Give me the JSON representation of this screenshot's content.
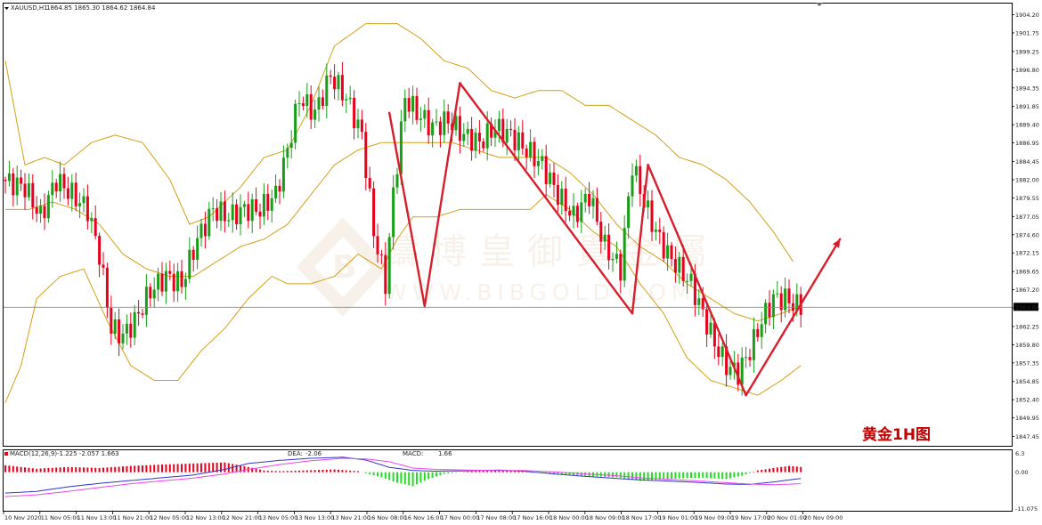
{
  "header": {
    "symbol": "XAUUSD,H1",
    "ohlc": "1864.85 1865.30 1864.62 1864.84"
  },
  "annotation": {
    "title": "黄金1H图"
  },
  "watermark": {
    "cn": "鑄博皇御貴金屬",
    "url": "WWW.BIBGOLD.COM"
  },
  "indicator": {
    "name": "MACD(12,26,9)",
    "values": "-1.225 -2.057 1.663",
    "dea_label": "DEA:",
    "dea_value": "-2.06",
    "macd_label": "MACD:",
    "macd_value": "1.66",
    "y_ticks": [
      "6.3",
      "0.00",
      "-11.075"
    ]
  },
  "colors": {
    "bull": "#1a9e1a",
    "bear": "#e8001c",
    "band": "#d4a017",
    "zigzag": "#d81e2a",
    "price_line": "#888888",
    "macd_pos": "#e8001c",
    "macd_neg": "#22dd22",
    "dif_line": "#3333cc",
    "dea_line": "#ee44ee"
  },
  "chart_data": {
    "type": "candlestick",
    "symbol": "XAUUSD",
    "timeframe": "H1",
    "current_price": 1864.84,
    "current_price_label": "1864.84",
    "ylim": [
      1846.2,
      1905.7
    ],
    "y_ticks": [
      "1904.20",
      "1901.75",
      "1899.25",
      "1896.80",
      "1894.35",
      "1891.85",
      "1889.40",
      "1886.95",
      "1884.45",
      "1882.00",
      "1879.55",
      "1877.05",
      "1874.60",
      "1872.15",
      "1869.65",
      "1867.20",
      "1864.75",
      "1862.25",
      "1859.80",
      "1857.35",
      "1854.85",
      "1852.40",
      "1849.95",
      "1847.45"
    ],
    "x_labels": [
      "10 Nov 2020",
      "11 Nov 05:00",
      "11 Nov 13:00",
      "11 Nov 21:00",
      "12 Nov 05:00",
      "12 Nov 13:00",
      "12 Nov 21:00",
      "13 Nov 05:00",
      "13 Nov 13:00",
      "13 Nov 21:00",
      "16 Nov 08:00",
      "16 Nov 16:00",
      "17 Nov 00:00",
      "17 Nov 08:00",
      "17 Nov 16:00",
      "18 Nov 00:00",
      "18 Nov 09:00",
      "18 Nov 17:00",
      "19 Nov 01:00",
      "19 Nov 09:00",
      "19 Nov 17:00",
      "20 Nov 01:00",
      "20 Nov 09:00"
    ],
    "price_anchors": [
      [
        0,
        1882
      ],
      [
        6,
        1881
      ],
      [
        10,
        1877
      ],
      [
        14,
        1882
      ],
      [
        18,
        1880
      ],
      [
        22,
        1878
      ],
      [
        25,
        1872
      ],
      [
        28,
        1862
      ],
      [
        31,
        1861
      ],
      [
        34,
        1863
      ],
      [
        38,
        1867
      ],
      [
        42,
        1869
      ],
      [
        46,
        1868
      ],
      [
        50,
        1874
      ],
      [
        54,
        1878
      ],
      [
        58,
        1877
      ],
      [
        62,
        1878
      ],
      [
        66,
        1878
      ],
      [
        70,
        1880
      ],
      [
        73,
        1886
      ],
      [
        76,
        1893
      ],
      [
        80,
        1891
      ],
      [
        84,
        1896
      ],
      [
        88,
        1893
      ],
      [
        92,
        1888
      ],
      [
        95,
        1875
      ],
      [
        98,
        1868
      ],
      [
        100,
        1880
      ],
      [
        103,
        1893
      ],
      [
        106,
        1891
      ],
      [
        110,
        1889
      ],
      [
        114,
        1890
      ],
      [
        118,
        1888
      ],
      [
        122,
        1887
      ],
      [
        126,
        1889
      ],
      [
        130,
        1888
      ],
      [
        134,
        1886
      ],
      [
        138,
        1884
      ],
      [
        142,
        1880
      ],
      [
        146,
        1877
      ],
      [
        150,
        1880
      ],
      [
        154,
        1873
      ],
      [
        158,
        1870
      ],
      [
        161,
        1884
      ],
      [
        164,
        1879
      ],
      [
        167,
        1875
      ],
      [
        170,
        1872
      ],
      [
        173,
        1870
      ],
      [
        176,
        1868
      ],
      [
        179,
        1864
      ],
      [
        182,
        1860
      ],
      [
        185,
        1857
      ],
      [
        188,
        1856
      ],
      [
        191,
        1859
      ],
      [
        194,
        1863
      ],
      [
        197,
        1866
      ],
      [
        200,
        1866
      ],
      [
        203,
        1865
      ]
    ],
    "bands": {
      "upper": [
        [
          0,
          1898
        ],
        [
          5,
          1884
        ],
        [
          10,
          1885
        ],
        [
          15,
          1884
        ],
        [
          22,
          1887
        ],
        [
          28,
          1888
        ],
        [
          35,
          1887
        ],
        [
          42,
          1882
        ],
        [
          47,
          1876
        ],
        [
          52,
          1877
        ],
        [
          60,
          1881
        ],
        [
          66,
          1885
        ],
        [
          72,
          1886
        ],
        [
          78,
          1892
        ],
        [
          84,
          1900
        ],
        [
          92,
          1903
        ],
        [
          100,
          1903
        ],
        [
          106,
          1901
        ],
        [
          112,
          1898
        ],
        [
          118,
          1897
        ],
        [
          124,
          1894
        ],
        [
          130,
          1893
        ],
        [
          136,
          1894
        ],
        [
          142,
          1894
        ],
        [
          148,
          1892
        ],
        [
          154,
          1892
        ],
        [
          160,
          1890
        ],
        [
          166,
          1888
        ],
        [
          172,
          1885
        ],
        [
          178,
          1884
        ],
        [
          184,
          1882
        ],
        [
          190,
          1879
        ],
        [
          196,
          1875
        ],
        [
          201,
          1871
        ]
      ],
      "middle": [
        [
          0,
          1878
        ],
        [
          6,
          1878
        ],
        [
          12,
          1879
        ],
        [
          18,
          1878
        ],
        [
          24,
          1876
        ],
        [
          30,
          1872
        ],
        [
          36,
          1870
        ],
        [
          42,
          1869
        ],
        [
          48,
          1869
        ],
        [
          54,
          1871
        ],
        [
          60,
          1873
        ],
        [
          66,
          1874
        ],
        [
          72,
          1876
        ],
        [
          78,
          1880
        ],
        [
          84,
          1884
        ],
        [
          90,
          1886
        ],
        [
          96,
          1887
        ],
        [
          102,
          1887
        ],
        [
          108,
          1887
        ],
        [
          114,
          1887
        ],
        [
          120,
          1886
        ],
        [
          126,
          1885
        ],
        [
          132,
          1885
        ],
        [
          138,
          1885
        ],
        [
          144,
          1883
        ],
        [
          150,
          1880
        ],
        [
          156,
          1876
        ],
        [
          162,
          1873
        ],
        [
          168,
          1871
        ],
        [
          174,
          1868
        ],
        [
          180,
          1866
        ],
        [
          186,
          1864
        ],
        [
          192,
          1863
        ],
        [
          198,
          1864
        ],
        [
          203,
          1865
        ]
      ],
      "lower": [
        [
          0,
          1852
        ],
        [
          4,
          1857
        ],
        [
          8,
          1866
        ],
        [
          14,
          1869
        ],
        [
          20,
          1870
        ],
        [
          26,
          1863
        ],
        [
          32,
          1857
        ],
        [
          38,
          1855
        ],
        [
          44,
          1855
        ],
        [
          50,
          1859
        ],
        [
          56,
          1862
        ],
        [
          62,
          1866
        ],
        [
          68,
          1869
        ],
        [
          72,
          1868
        ],
        [
          78,
          1868
        ],
        [
          84,
          1869
        ],
        [
          90,
          1872
        ],
        [
          96,
          1870
        ],
        [
          100,
          1874
        ],
        [
          104,
          1877
        ],
        [
          110,
          1877
        ],
        [
          116,
          1878
        ],
        [
          122,
          1878
        ],
        [
          128,
          1878
        ],
        [
          134,
          1878
        ],
        [
          138,
          1880
        ],
        [
          144,
          1878
        ],
        [
          150,
          1875
        ],
        [
          156,
          1873
        ],
        [
          162,
          1868
        ],
        [
          168,
          1864
        ],
        [
          174,
          1858
        ],
        [
          180,
          1855
        ],
        [
          186,
          1854
        ],
        [
          192,
          1853
        ],
        [
          198,
          1855
        ],
        [
          203,
          1857
        ]
      ]
    },
    "zigzag": [
      [
        98,
        1891
      ],
      [
        107,
        1865
      ],
      [
        116,
        1895
      ],
      [
        160,
        1864
      ],
      [
        164,
        1884
      ],
      [
        189,
        1853
      ],
      [
        213,
        1874
      ]
    ],
    "macd": {
      "histogram": [
        [
          0,
          2
        ],
        [
          8,
          1
        ],
        [
          16,
          1.5
        ],
        [
          24,
          1.2
        ],
        [
          32,
          1.8
        ],
        [
          40,
          2.2
        ],
        [
          48,
          2.5
        ],
        [
          56,
          2.8
        ],
        [
          62,
          1.5
        ],
        [
          66,
          0.5
        ],
        [
          70,
          0.3
        ],
        [
          76,
          0.5
        ],
        [
          84,
          0.8
        ],
        [
          90,
          0.3
        ],
        [
          96,
          -1.5
        ],
        [
          100,
          -3
        ],
        [
          104,
          -4
        ],
        [
          108,
          -2
        ],
        [
          112,
          -0.5
        ],
        [
          118,
          0.2
        ],
        [
          126,
          0.5
        ],
        [
          132,
          0.3
        ],
        [
          138,
          -0.3
        ],
        [
          144,
          -0.8
        ],
        [
          150,
          -1.2
        ],
        [
          156,
          -1.5
        ],
        [
          162,
          -2.5
        ],
        [
          166,
          -2.2
        ],
        [
          172,
          -1.8
        ],
        [
          178,
          -1.6
        ],
        [
          184,
          -2
        ],
        [
          188,
          -1
        ],
        [
          192,
          0.5
        ],
        [
          196,
          1.2
        ],
        [
          200,
          1.8
        ],
        [
          203,
          1.5
        ]
      ],
      "dif": [
        [
          0,
          -6
        ],
        [
          8,
          -5.5
        ],
        [
          16,
          -4.2
        ],
        [
          24,
          -3.2
        ],
        [
          32,
          -2.4
        ],
        [
          40,
          -1.6
        ],
        [
          48,
          -0.8
        ],
        [
          56,
          0.8
        ],
        [
          62,
          2.5
        ],
        [
          70,
          3.4
        ],
        [
          78,
          4
        ],
        [
          86,
          4.3
        ],
        [
          92,
          3.5
        ],
        [
          98,
          1.4
        ],
        [
          104,
          0.5
        ],
        [
          110,
          0.3
        ],
        [
          118,
          0.4
        ],
        [
          126,
          0.6
        ],
        [
          132,
          0.3
        ],
        [
          140,
          -0.5
        ],
        [
          148,
          -1.2
        ],
        [
          156,
          -1.8
        ],
        [
          162,
          -2.2
        ],
        [
          170,
          -2.6
        ],
        [
          178,
          -3
        ],
        [
          184,
          -3.4
        ],
        [
          190,
          -3.5
        ],
        [
          196,
          -2.8
        ],
        [
          203,
          -1.8
        ]
      ],
      "dea": [
        [
          0,
          -7
        ],
        [
          8,
          -6.5
        ],
        [
          16,
          -5.5
        ],
        [
          24,
          -4.4
        ],
        [
          32,
          -3.3
        ],
        [
          40,
          -2.5
        ],
        [
          48,
          -1.7
        ],
        [
          56,
          -0.5
        ],
        [
          62,
          0.8
        ],
        [
          70,
          2.2
        ],
        [
          78,
          3.3
        ],
        [
          86,
          4
        ],
        [
          92,
          3.8
        ],
        [
          98,
          3
        ],
        [
          104,
          1.2
        ],
        [
          110,
          0.8
        ],
        [
          118,
          0.6
        ],
        [
          126,
          0.5
        ],
        [
          132,
          0.5
        ],
        [
          140,
          0.1
        ],
        [
          148,
          -0.5
        ],
        [
          156,
          -1
        ],
        [
          162,
          -1.6
        ],
        [
          170,
          -2.1
        ],
        [
          178,
          -2.6
        ],
        [
          184,
          -3
        ],
        [
          190,
          -3.4
        ],
        [
          196,
          -3.6
        ],
        [
          203,
          -3.3
        ]
      ]
    }
  }
}
